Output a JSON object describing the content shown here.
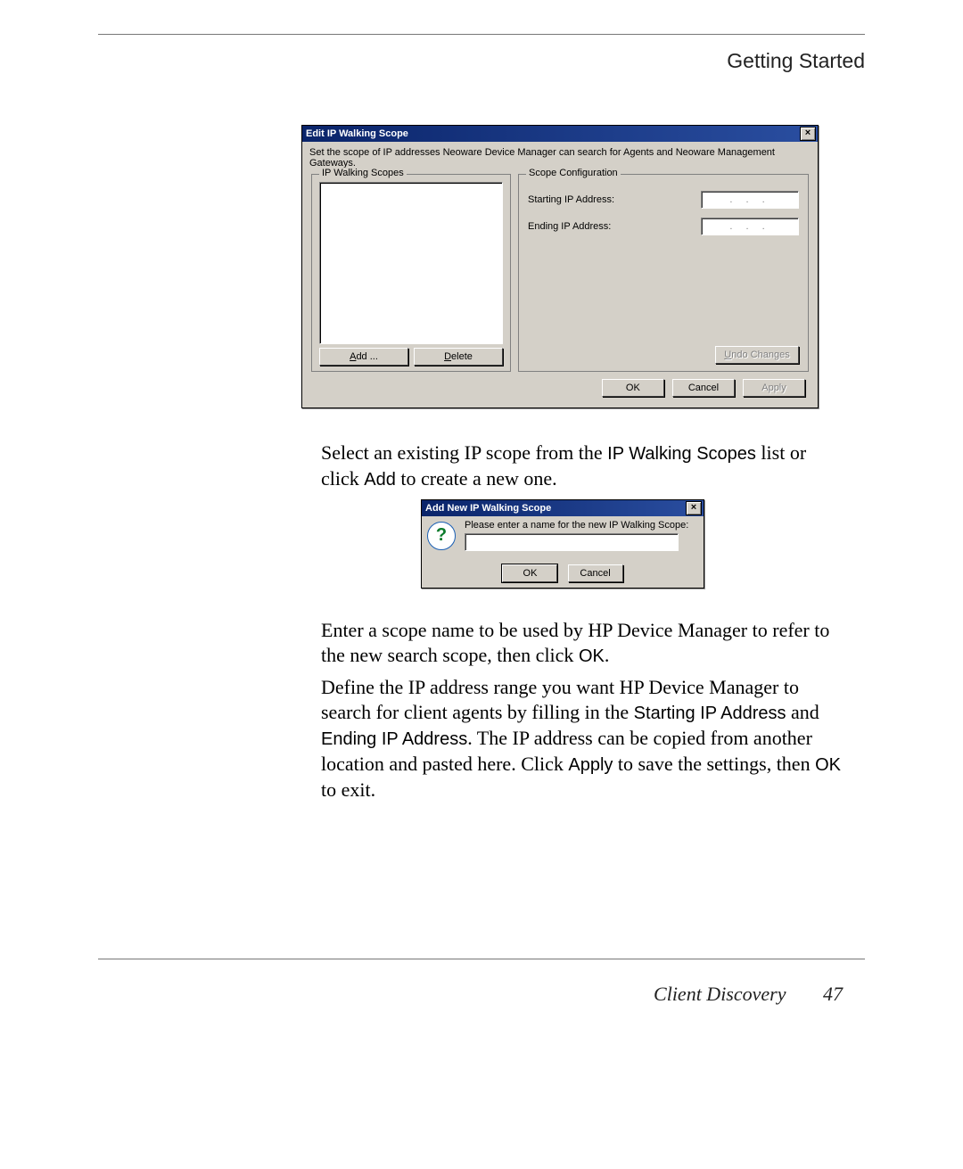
{
  "header": {
    "section_title": "Getting Started"
  },
  "dialog1": {
    "title": "Edit IP Walking Scope",
    "close_glyph": "×",
    "description": "Set the scope of IP addresses Neoware Device Manager can search for Agents and Neoware Management Gateways.",
    "group_left_legend": "IP Walking Scopes",
    "group_right_legend": "Scope Configuration",
    "starting_ip_label": "Starting IP Address:",
    "ending_ip_label": "Ending IP Address:",
    "ip_placeholder": ". . .",
    "add_label": "Add ...",
    "delete_label": "Delete",
    "undo_label": "Undo Changes",
    "ok_label": "OK",
    "cancel_label": "Cancel",
    "apply_label": "Apply"
  },
  "para1": {
    "t1": "Select an existing IP scope from the ",
    "term1": "IP Walking Scopes",
    "t2": " list or click ",
    "term2": "Add",
    "t3": " to create a new one."
  },
  "dialog2": {
    "title": "Add New IP Walking Scope",
    "close_glyph": "×",
    "prompt": "Please enter a name for the new IP Walking Scope:",
    "ok_label": "OK",
    "cancel_label": "Cancel"
  },
  "para2": {
    "t1": "Enter a scope name to be used by HP Device Manager to refer to the new search scope, then click ",
    "term1": "OK",
    "t2": "."
  },
  "para3": {
    "t1": "Define the IP address range you want HP Device Manager to search for client agents by filling in the ",
    "term1": "Starting IP Address",
    "t2": " and ",
    "term2": "Ending IP Address",
    "t3": ". The IP address can be copied from another location and pasted here. Click ",
    "term3": "Apply",
    "t4": " to save the settings, then ",
    "term4": "OK",
    "t5": " to exit."
  },
  "footer": {
    "chapter": "Client Discovery",
    "page": "47"
  }
}
